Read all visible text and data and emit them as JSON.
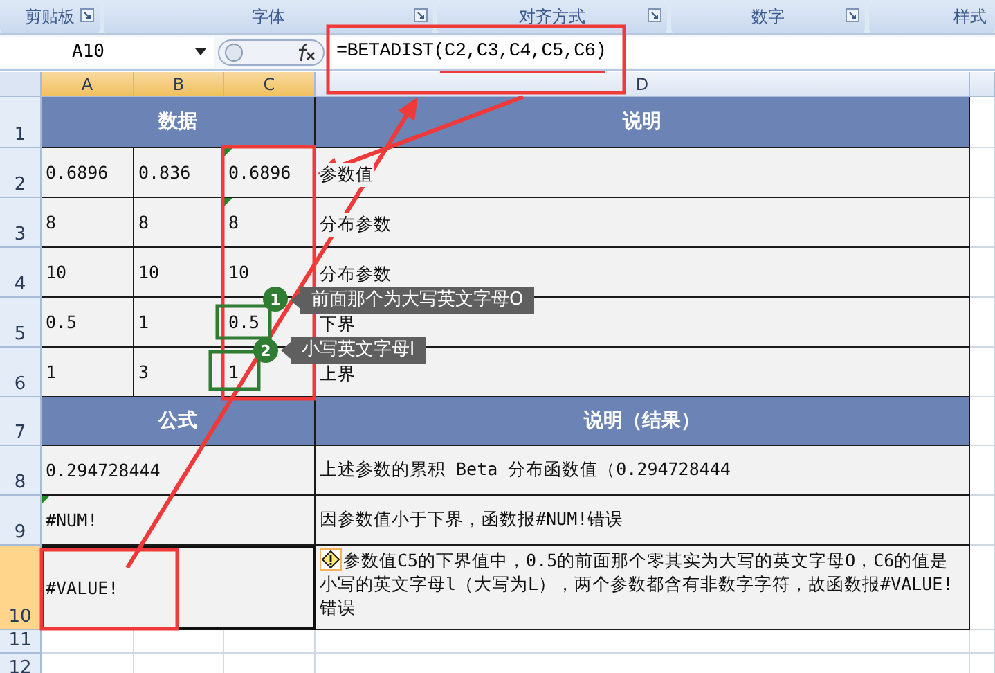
{
  "ribbon_groups": [
    {
      "label": "剪贴板",
      "launcher": true
    },
    {
      "label": "字体",
      "launcher": true
    },
    {
      "label": "对齐方式",
      "launcher": true
    },
    {
      "label": "数字",
      "launcher": true
    },
    {
      "label": "样式",
      "launcher": false
    }
  ],
  "name_box": "A10",
  "formula": "=BETADIST(C2,C3,C4,C5,C6)",
  "columns": [
    {
      "label": "A",
      "selected": true
    },
    {
      "label": "B",
      "selected": true
    },
    {
      "label": "C",
      "selected": true
    },
    {
      "label": "D",
      "selected": false
    }
  ],
  "rows": [
    {
      "label": "1",
      "selected": false
    },
    {
      "label": "2",
      "selected": false
    },
    {
      "label": "3",
      "selected": false
    },
    {
      "label": "4",
      "selected": false
    },
    {
      "label": "5",
      "selected": false
    },
    {
      "label": "6",
      "selected": false
    },
    {
      "label": "7",
      "selected": false
    },
    {
      "label": "8",
      "selected": false
    },
    {
      "label": "9",
      "selected": false
    },
    {
      "label": "10",
      "selected": true
    },
    {
      "label": "11",
      "selected": false
    },
    {
      "label": "12",
      "selected": false
    }
  ],
  "sheet": {
    "header_1": {
      "left": "数据",
      "right": "说明"
    },
    "data_rows": [
      {
        "cells": [
          {
            "text": "0.6896",
            "flag": false
          },
          {
            "text": "0.836",
            "flag": false
          },
          {
            "text": "0.6896",
            "flag": true
          }
        ],
        "note": "参数值"
      },
      {
        "cells": [
          {
            "text": "8",
            "flag": false
          },
          {
            "text": "8",
            "flag": false
          },
          {
            "text": "8",
            "flag": true
          }
        ],
        "note": "分布参数"
      },
      {
        "cells": [
          {
            "text": "10",
            "flag": false
          },
          {
            "text": "10",
            "flag": false
          },
          {
            "text": "10",
            "flag": false
          }
        ],
        "note": "分布参数"
      },
      {
        "cells": [
          {
            "text": "0.5",
            "flag": false
          },
          {
            "text": "1",
            "flag": false
          },
          {
            "text": "0.5",
            "flag": false
          }
        ],
        "note": "下界"
      },
      {
        "cells": [
          {
            "text": "1",
            "flag": false
          },
          {
            "text": "3",
            "flag": false
          },
          {
            "text": "1",
            "flag": false
          }
        ],
        "note": "上界"
      }
    ],
    "header_2": {
      "left": "公式",
      "right": "说明（结果）"
    },
    "result_rows": [
      {
        "formula": "0.294728444",
        "flag": false,
        "warning": false,
        "note": "上述参数的累积 Beta 分布函数值（0.294728444"
      },
      {
        "formula": "#NUM!",
        "flag": true,
        "warning": false,
        "note": "因参数值小于下界，函数报#NUM!错误"
      },
      {
        "formula": "#VALUE!",
        "flag": false,
        "warning": true,
        "note": "参数值C5的下界值中，0.5的前面那个零其实为大写的英文字母O，C6的值是小写的英文字母l（大写为L），两个参数都含有非数字字符，故函数报#VALUE!错误"
      }
    ]
  },
  "callouts": [
    {
      "number": "1",
      "text": "前面那个为大写英文字母O"
    },
    {
      "number": "2",
      "text": "小写英文字母l"
    }
  ]
}
